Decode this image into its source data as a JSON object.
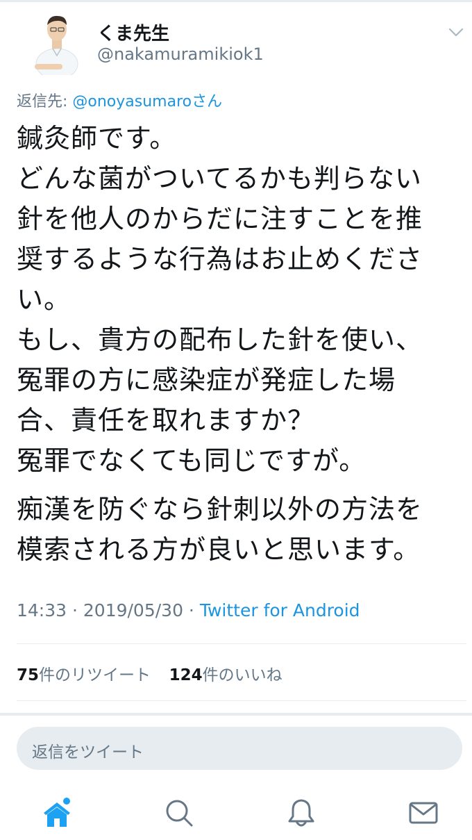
{
  "author": {
    "display_name": "くま先生",
    "handle": "@nakamuramikiok1"
  },
  "reply_to": {
    "prefix": "返信先: ",
    "target": "@onoyasumaro",
    "suffix": "さん"
  },
  "tweet": {
    "lines_1": [
      "鍼灸師です。",
      "どんな菌がついてるかも判らない",
      "針を他人のからだに注すことを推",
      "奨するような行為はお止めくださ",
      "い。",
      "もし、貴方の配布した針を使い、",
      "冤罪の方に感染症が発症した場",
      "合、責任を取れますか？",
      "冤罪でなくても同じですが。"
    ],
    "lines_2": [
      "痴漢を防ぐなら針刺以外の方法を",
      "模索される方が良いと思います。"
    ]
  },
  "meta": {
    "time": "14:33",
    "separator": " · ",
    "date": "2019/05/30",
    "source": "Twitter for Android"
  },
  "stats": {
    "retweets_count": "75",
    "retweets_label": "件のリツイート",
    "likes_count": "124",
    "likes_label": "件のいいね"
  },
  "reply_box": {
    "placeholder": "返信をツイート"
  },
  "tabbar": {
    "icons": [
      "home-icon",
      "search-icon",
      "notifications-icon",
      "messages-icon"
    ]
  },
  "colors": {
    "accent": "#1da1f2",
    "link": "#1b95e0",
    "secondary_text": "#657786",
    "divider": "#e6ecf0"
  }
}
